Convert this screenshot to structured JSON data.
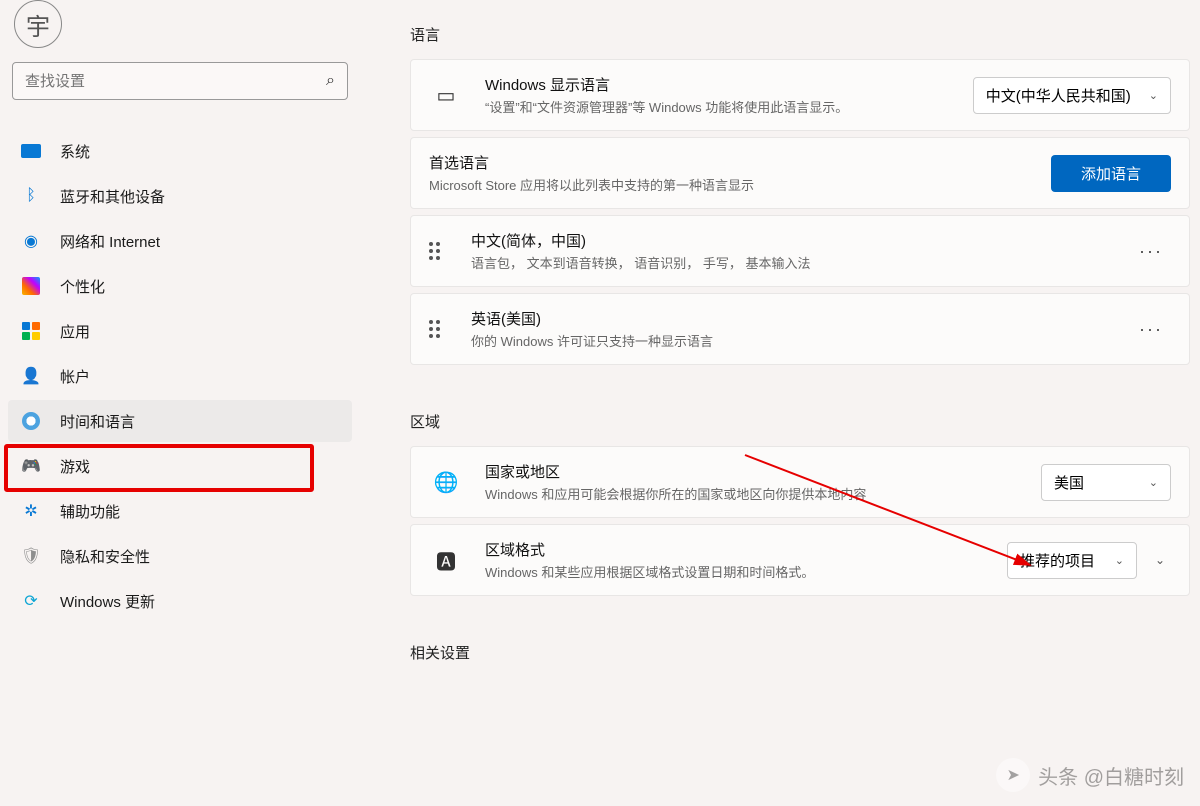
{
  "search": {
    "placeholder": "查找设置"
  },
  "sidebar": {
    "items": [
      {
        "label": "系统"
      },
      {
        "label": "蓝牙和其他设备"
      },
      {
        "label": "网络和 Internet"
      },
      {
        "label": "个性化"
      },
      {
        "label": "应用"
      },
      {
        "label": "帐户"
      },
      {
        "label": "时间和语言"
      },
      {
        "label": "游戏"
      },
      {
        "label": "辅助功能"
      },
      {
        "label": "隐私和安全性"
      },
      {
        "label": "Windows 更新"
      }
    ]
  },
  "sections": {
    "language_title": "语言",
    "region_title": "区域",
    "related_title": "相关设置"
  },
  "display_language": {
    "title": "Windows 显示语言",
    "desc": "“设置”和“文件资源管理器”等 Windows 功能将使用此语言显示。",
    "value": "中文(中华人民共和国)"
  },
  "preferred": {
    "title": "首选语言",
    "desc": "Microsoft Store 应用将以此列表中支持的第一种语言显示",
    "button": "添加语言"
  },
  "languages": [
    {
      "title": "中文(简体，中国)",
      "desc": "语言包，  文本到语音转换，  语音识别，  手写，  基本输入法"
    },
    {
      "title": "英语(美国)",
      "desc": "你的 Windows 许可证只支持一种显示语言"
    }
  ],
  "country": {
    "title": "国家或地区",
    "desc": "Windows 和应用可能会根据你所在的国家或地区向你提供本地内容",
    "value": "美国"
  },
  "format": {
    "title": "区域格式",
    "desc": "Windows 和某些应用根据区域格式设置日期和时间格式。",
    "value": "推荐的项目"
  },
  "watermark": "头条 @白糖时刻"
}
